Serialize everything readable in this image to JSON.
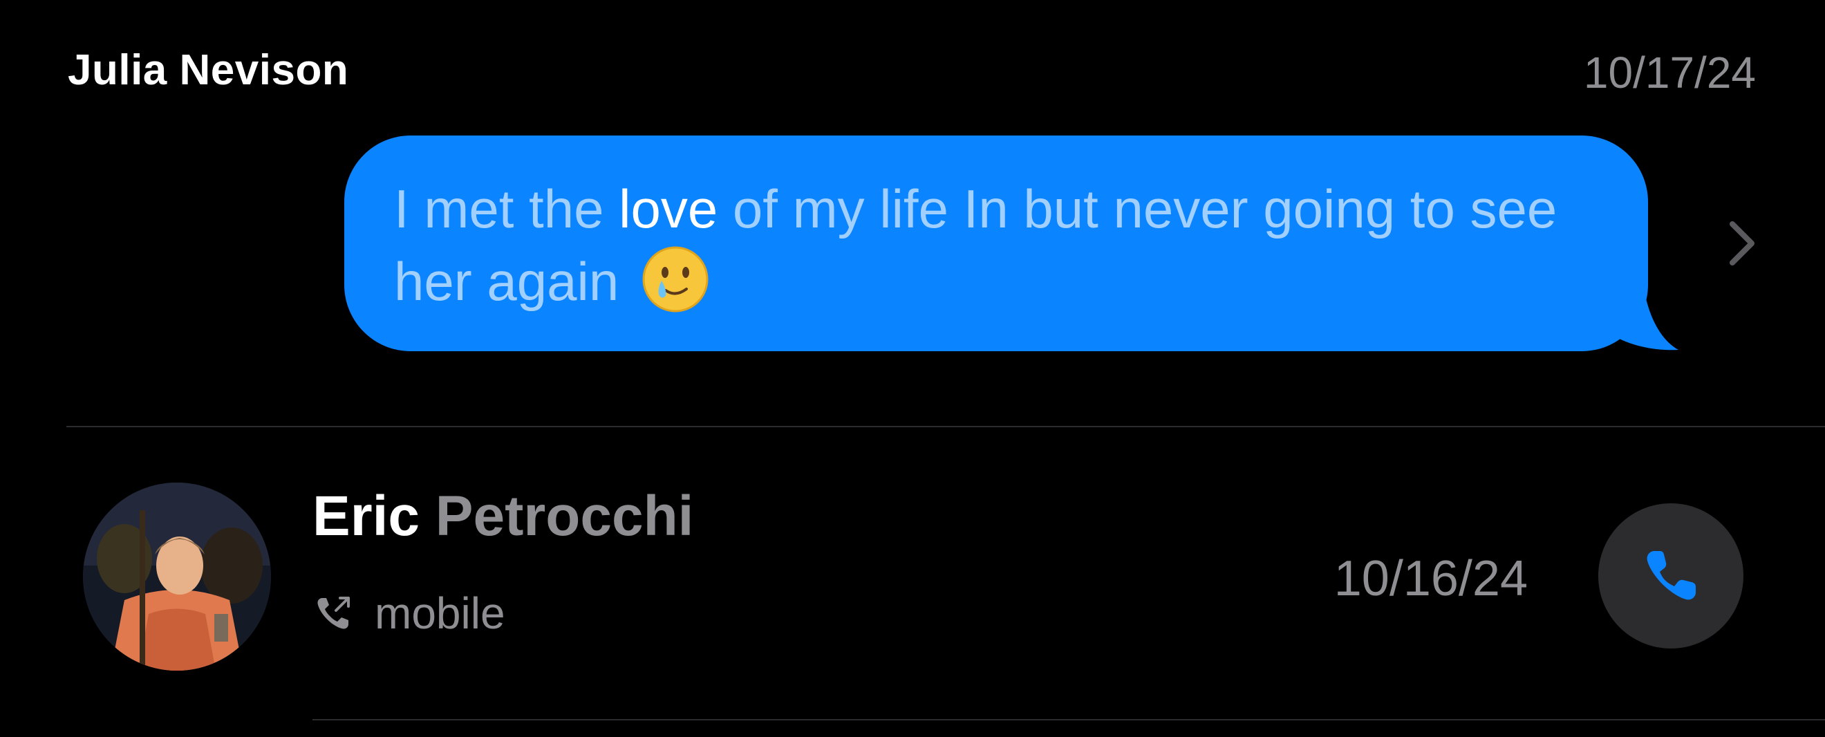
{
  "message": {
    "sender": "Julia Nevison",
    "date": "10/17/24",
    "text_before": "I met the ",
    "text_highlight": "love",
    "text_after": " of my life In but never going to see her again",
    "emoji": "face-holding-back-tears",
    "bubble_color": "#0a84ff"
  },
  "call": {
    "first_name": "Eric",
    "last_name": " Petrocchi",
    "type_label": "mobile",
    "date": "10/16/24",
    "accent_color": "#0a84ff"
  }
}
